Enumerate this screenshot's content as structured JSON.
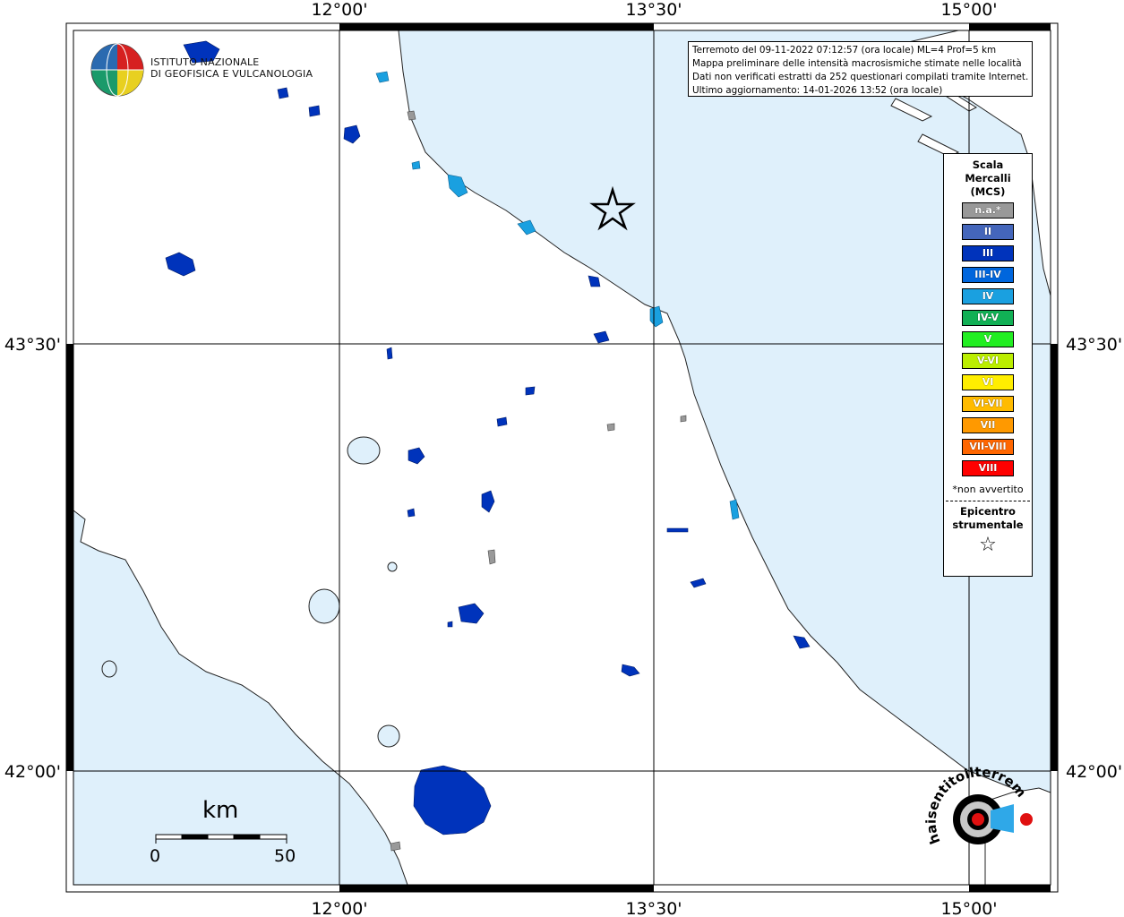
{
  "map": {
    "top_ticks": [
      "12°00'",
      "13°30'",
      "15°00'"
    ],
    "bottom_ticks": [
      "12°00'",
      "13°30'",
      "15°00'"
    ],
    "left_ticks": [
      "43°30'",
      "42°00'"
    ],
    "right_ticks": [
      "43°30'",
      "42°00'"
    ],
    "colors": {
      "sea": "#dff0fb",
      "land": "#ffffff",
      "intensity_III": "#0033bb",
      "intensity_IV": "#1aa0e0",
      "not_felt": "#999999"
    }
  },
  "logo": {
    "line1": "ISTITUTO NAZIONALE",
    "line2": "DI GEOFISICA E VULCANOLOGIA"
  },
  "info": {
    "line1": "Terremoto del 09-11-2022 07:12:57 (ora locale) ML=4 Prof=5 km",
    "line2": "Mappa preliminare delle intensità macrosismiche stimate nelle località",
    "line3": "Dati non verificati estratti da 252 questionari compilati tramite Internet.",
    "line4": "Ultimo aggiornamento: 14-01-2026 13:52 (ora locale)"
  },
  "legend": {
    "title_line1": "Scala",
    "title_line2": "Mercalli",
    "title_line3": "(MCS)",
    "items": [
      {
        "label": "n.a.*",
        "color": "#999999"
      },
      {
        "label": "II",
        "color": "#4466bb"
      },
      {
        "label": "III",
        "color": "#0033bb"
      },
      {
        "label": "III-IV",
        "color": "#0066dd"
      },
      {
        "label": "IV",
        "color": "#1aa0e0"
      },
      {
        "label": "IV-V",
        "color": "#11b055"
      },
      {
        "label": "V",
        "color": "#22ee22"
      },
      {
        "label": "V-VI",
        "color": "#bbee00"
      },
      {
        "label": "VI",
        "color": "#ffee00"
      },
      {
        "label": "VI-VII",
        "color": "#ffbb00"
      },
      {
        "label": "VII",
        "color": "#ff9900"
      },
      {
        "label": "VII-VIII",
        "color": "#ff6600"
      },
      {
        "label": "VIII",
        "color": "#ff0000"
      }
    ],
    "note": "*non avvertito",
    "epicentre_line1": "Epicentro",
    "epicentre_line2": "strumentale"
  },
  "scalebar": {
    "unit": "km",
    "start": "0",
    "end": "50"
  },
  "badge": {
    "text": "haisentitoilterremoto.it · WWW"
  }
}
